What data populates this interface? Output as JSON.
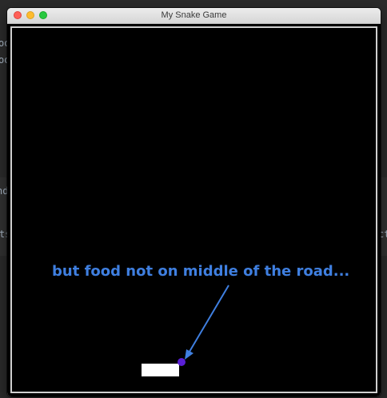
{
  "background_editor": {
    "fragments": [
      "oo",
      "oo",
      "nd",
      "ts",
      "ct"
    ]
  },
  "window": {
    "title": "My Snake Game",
    "controls": [
      "close",
      "minimize",
      "zoom"
    ]
  },
  "game": {
    "background_color": "#000000",
    "snake_color": "#ffffff",
    "food_color": "#5a1fd6"
  },
  "annotation": {
    "text": "but food not on middle of the road...",
    "color": "#3f7fe0"
  }
}
